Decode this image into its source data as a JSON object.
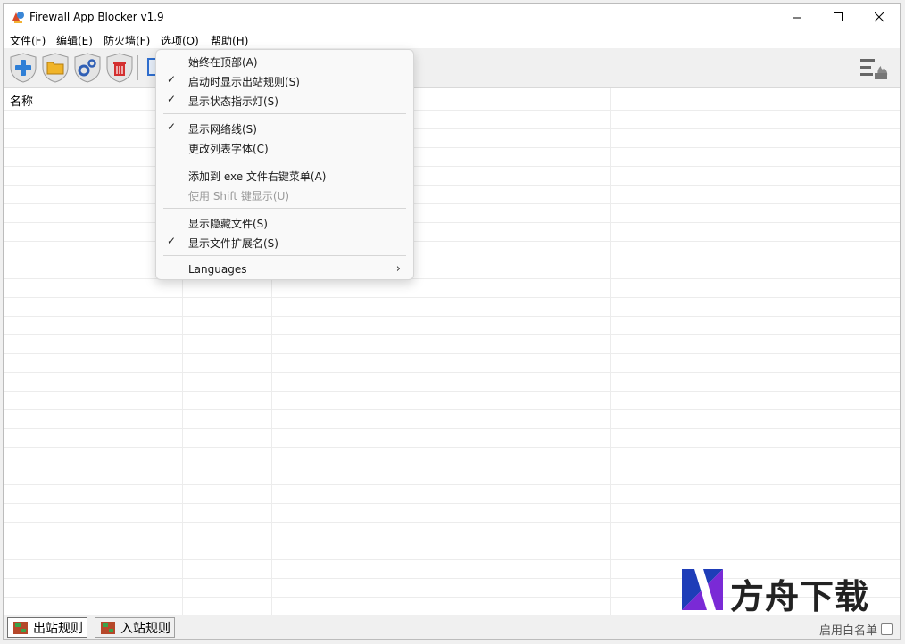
{
  "window": {
    "title": "Firewall App Blocker v1.9"
  },
  "menubar": {
    "items": [
      "文件(F)",
      "编辑(E)",
      "防火墙(F)",
      "选项(O)",
      "帮助(H)"
    ]
  },
  "listview": {
    "columns": [
      "名称"
    ]
  },
  "options_menu": {
    "items": [
      {
        "label": "始终在顶部(A)",
        "checked": false,
        "disabled": false
      },
      {
        "label": "启动时显示出站规则(S)",
        "checked": true,
        "disabled": false
      },
      {
        "label": "显示状态指示灯(S)",
        "checked": true,
        "disabled": false
      },
      {
        "label": "显示网络线(S)",
        "checked": true,
        "disabled": false
      },
      {
        "label": "更改列表字体(C)",
        "checked": false,
        "disabled": false
      },
      {
        "label": "添加到 exe 文件右键菜单(A)",
        "checked": false,
        "disabled": false
      },
      {
        "label": "使用 Shift 键显示(U)",
        "checked": false,
        "disabled": true
      },
      {
        "label": "显示隐藏文件(S)",
        "checked": false,
        "disabled": false
      },
      {
        "label": "显示文件扩展名(S)",
        "checked": true,
        "disabled": false
      },
      {
        "label": "Languages",
        "checked": false,
        "disabled": false,
        "submenu": true
      }
    ],
    "check_glyph": "✓",
    "arrow_glyph": "›"
  },
  "statusbar": {
    "tabs": [
      {
        "label": "出站规则",
        "active": true
      },
      {
        "label": "入站规则",
        "active": false
      }
    ],
    "whitelist_label": "启用白名单",
    "whitelist_checked": false
  },
  "watermark": {
    "text": "方舟下载"
  },
  "icons": {
    "toolbar": [
      "add-icon",
      "folder-icon",
      "settings-shield-icon",
      "delete-icon",
      "refresh-icon"
    ],
    "right": "firewall-menu-icon"
  },
  "colors": {
    "delete_red": "#d32f2f",
    "add_blue": "#2f7fd6",
    "folder_yellow": "#f0b429",
    "accent": "#2f6fd0"
  }
}
